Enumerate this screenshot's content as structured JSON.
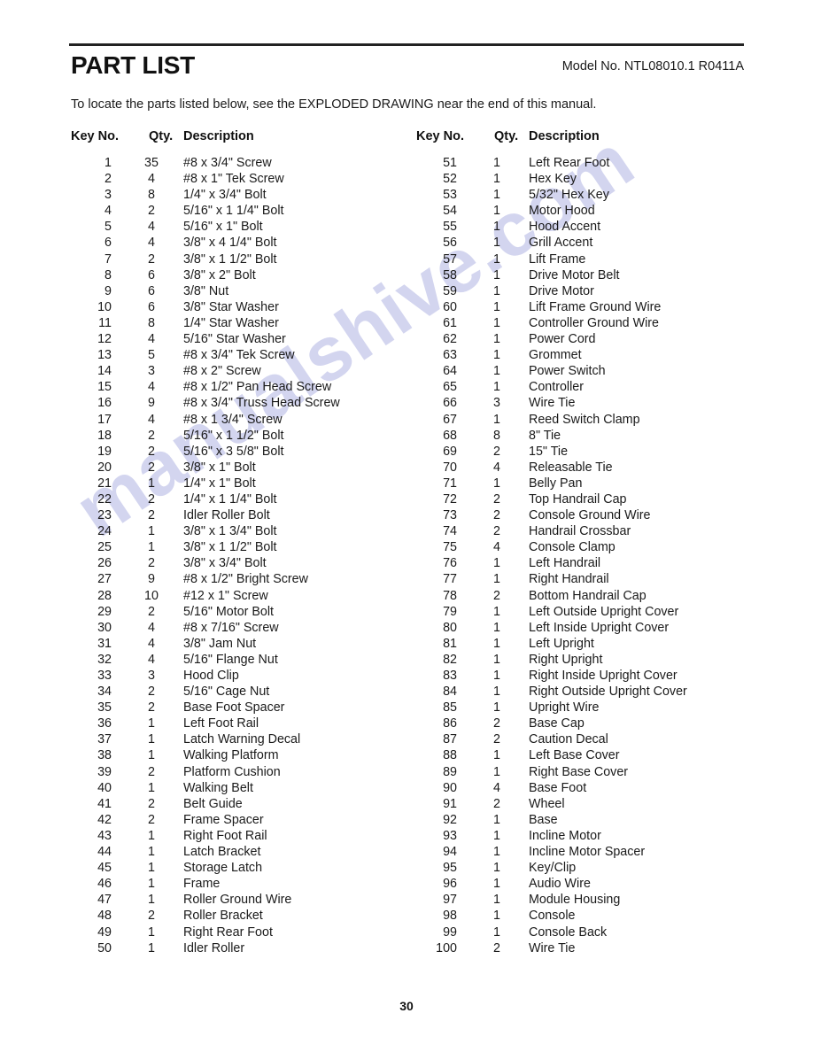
{
  "document": {
    "title": "PART LIST",
    "model_no": "Model No. NTL08010.1 R0411A",
    "intro": "To locate the parts listed below, see the EXPLODED DRAWING near the end of this manual.",
    "page_number": "30",
    "watermark": "manualshive.com",
    "watermark_color": "#b9bce6",
    "rule_color": "#222222"
  },
  "table": {
    "headers": {
      "key_no": "Key No.",
      "qty": "Qty.",
      "description": "Description"
    },
    "left_column": [
      {
        "key": "1",
        "qty": "35",
        "description": "#8 x 3/4\" Screw"
      },
      {
        "key": "2",
        "qty": "4",
        "description": "#8 x 1\" Tek Screw"
      },
      {
        "key": "3",
        "qty": "8",
        "description": "1/4\" x 3/4\" Bolt"
      },
      {
        "key": "4",
        "qty": "2",
        "description": "5/16\" x 1 1/4\" Bolt"
      },
      {
        "key": "5",
        "qty": "4",
        "description": "5/16\" x 1\" Bolt"
      },
      {
        "key": "6",
        "qty": "4",
        "description": "3/8\" x 4 1/4\" Bolt"
      },
      {
        "key": "7",
        "qty": "2",
        "description": "3/8\" x 1 1/2\" Bolt"
      },
      {
        "key": "8",
        "qty": "6",
        "description": "3/8\" x 2\" Bolt"
      },
      {
        "key": "9",
        "qty": "6",
        "description": "3/8\" Nut"
      },
      {
        "key": "10",
        "qty": "6",
        "description": "3/8\" Star Washer"
      },
      {
        "key": "11",
        "qty": "8",
        "description": "1/4\" Star Washer"
      },
      {
        "key": "12",
        "qty": "4",
        "description": "5/16\" Star Washer"
      },
      {
        "key": "13",
        "qty": "5",
        "description": "#8 x 3/4\" Tek Screw"
      },
      {
        "key": "14",
        "qty": "3",
        "description": "#8 x 2\" Screw"
      },
      {
        "key": "15",
        "qty": "4",
        "description": "#8 x 1/2\" Pan Head Screw"
      },
      {
        "key": "16",
        "qty": "9",
        "description": "#8 x 3/4\" Truss Head Screw"
      },
      {
        "key": "17",
        "qty": "4",
        "description": "#8 x 1 3/4\" Screw"
      },
      {
        "key": "18",
        "qty": "2",
        "description": "5/16\" x 1 1/2\" Bolt"
      },
      {
        "key": "19",
        "qty": "2",
        "description": "5/16\" x 3 5/8\" Bolt"
      },
      {
        "key": "20",
        "qty": "2",
        "description": "3/8\" x 1\" Bolt"
      },
      {
        "key": "21",
        "qty": "1",
        "description": "1/4\" x 1\" Bolt"
      },
      {
        "key": "22",
        "qty": "2",
        "description": "1/4\" x 1 1/4\" Bolt"
      },
      {
        "key": "23",
        "qty": "2",
        "description": "Idler Roller Bolt"
      },
      {
        "key": "24",
        "qty": "1",
        "description": "3/8\" x 1 3/4\" Bolt"
      },
      {
        "key": "25",
        "qty": "1",
        "description": "3/8\" x 1 1/2\" Bolt"
      },
      {
        "key": "26",
        "qty": "2",
        "description": "3/8\" x 3/4\" Bolt"
      },
      {
        "key": "27",
        "qty": "9",
        "description": "#8 x 1/2\" Bright Screw"
      },
      {
        "key": "28",
        "qty": "10",
        "description": "#12 x 1\" Screw"
      },
      {
        "key": "29",
        "qty": "2",
        "description": "5/16\" Motor Bolt"
      },
      {
        "key": "30",
        "qty": "4",
        "description": "#8 x 7/16\" Screw"
      },
      {
        "key": "31",
        "qty": "4",
        "description": "3/8\" Jam Nut"
      },
      {
        "key": "32",
        "qty": "4",
        "description": "5/16\" Flange Nut"
      },
      {
        "key": "33",
        "qty": "3",
        "description": "Hood Clip"
      },
      {
        "key": "34",
        "qty": "2",
        "description": "5/16\" Cage Nut"
      },
      {
        "key": "35",
        "qty": "2",
        "description": "Base Foot Spacer"
      },
      {
        "key": "36",
        "qty": "1",
        "description": "Left Foot Rail"
      },
      {
        "key": "37",
        "qty": "1",
        "description": "Latch Warning Decal"
      },
      {
        "key": "38",
        "qty": "1",
        "description": "Walking Platform"
      },
      {
        "key": "39",
        "qty": "2",
        "description": "Platform Cushion"
      },
      {
        "key": "40",
        "qty": "1",
        "description": "Walking Belt"
      },
      {
        "key": "41",
        "qty": "2",
        "description": "Belt Guide"
      },
      {
        "key": "42",
        "qty": "2",
        "description": "Frame Spacer"
      },
      {
        "key": "43",
        "qty": "1",
        "description": "Right Foot Rail"
      },
      {
        "key": "44",
        "qty": "1",
        "description": "Latch Bracket"
      },
      {
        "key": "45",
        "qty": "1",
        "description": "Storage Latch"
      },
      {
        "key": "46",
        "qty": "1",
        "description": "Frame"
      },
      {
        "key": "47",
        "qty": "1",
        "description": "Roller Ground Wire"
      },
      {
        "key": "48",
        "qty": "2",
        "description": "Roller Bracket"
      },
      {
        "key": "49",
        "qty": "1",
        "description": "Right Rear Foot"
      },
      {
        "key": "50",
        "qty": "1",
        "description": "Idler Roller"
      }
    ],
    "right_column": [
      {
        "key": "51",
        "qty": "1",
        "description": "Left Rear Foot"
      },
      {
        "key": "52",
        "qty": "1",
        "description": "Hex Key"
      },
      {
        "key": "53",
        "qty": "1",
        "description": "5/32\" Hex Key"
      },
      {
        "key": "54",
        "qty": "1",
        "description": "Motor Hood"
      },
      {
        "key": "55",
        "qty": "1",
        "description": "Hood Accent"
      },
      {
        "key": "56",
        "qty": "1",
        "description": "Grill Accent"
      },
      {
        "key": "57",
        "qty": "1",
        "description": "Lift Frame"
      },
      {
        "key": "58",
        "qty": "1",
        "description": "Drive Motor Belt"
      },
      {
        "key": "59",
        "qty": "1",
        "description": "Drive Motor"
      },
      {
        "key": "60",
        "qty": "1",
        "description": "Lift Frame Ground Wire"
      },
      {
        "key": "61",
        "qty": "1",
        "description": "Controller Ground Wire"
      },
      {
        "key": "62",
        "qty": "1",
        "description": "Power Cord"
      },
      {
        "key": "63",
        "qty": "1",
        "description": "Grommet"
      },
      {
        "key": "64",
        "qty": "1",
        "description": "Power Switch"
      },
      {
        "key": "65",
        "qty": "1",
        "description": "Controller"
      },
      {
        "key": "66",
        "qty": "3",
        "description": "Wire Tie"
      },
      {
        "key": "67",
        "qty": "1",
        "description": "Reed Switch Clamp"
      },
      {
        "key": "68",
        "qty": "8",
        "description": "8\" Tie"
      },
      {
        "key": "69",
        "qty": "2",
        "description": "15\" Tie"
      },
      {
        "key": "70",
        "qty": "4",
        "description": "Releasable Tie"
      },
      {
        "key": "71",
        "qty": "1",
        "description": "Belly Pan"
      },
      {
        "key": "72",
        "qty": "2",
        "description": "Top Handrail Cap"
      },
      {
        "key": "73",
        "qty": "2",
        "description": "Console Ground Wire"
      },
      {
        "key": "74",
        "qty": "2",
        "description": "Handrail Crossbar"
      },
      {
        "key": "75",
        "qty": "4",
        "description": "Console Clamp"
      },
      {
        "key": "76",
        "qty": "1",
        "description": "Left Handrail"
      },
      {
        "key": "77",
        "qty": "1",
        "description": "Right Handrail"
      },
      {
        "key": "78",
        "qty": "2",
        "description": "Bottom Handrail Cap"
      },
      {
        "key": "79",
        "qty": "1",
        "description": "Left Outside Upright Cover"
      },
      {
        "key": "80",
        "qty": "1",
        "description": "Left Inside Upright Cover"
      },
      {
        "key": "81",
        "qty": "1",
        "description": "Left Upright"
      },
      {
        "key": "82",
        "qty": "1",
        "description": "Right Upright"
      },
      {
        "key": "83",
        "qty": "1",
        "description": "Right Inside Upright Cover"
      },
      {
        "key": "84",
        "qty": "1",
        "description": "Right Outside Upright Cover"
      },
      {
        "key": "85",
        "qty": "1",
        "description": "Upright Wire"
      },
      {
        "key": "86",
        "qty": "2",
        "description": "Base Cap"
      },
      {
        "key": "87",
        "qty": "2",
        "description": "Caution Decal"
      },
      {
        "key": "88",
        "qty": "1",
        "description": "Left Base Cover"
      },
      {
        "key": "89",
        "qty": "1",
        "description": "Right Base Cover"
      },
      {
        "key": "90",
        "qty": "4",
        "description": "Base Foot"
      },
      {
        "key": "91",
        "qty": "2",
        "description": "Wheel"
      },
      {
        "key": "92",
        "qty": "1",
        "description": "Base"
      },
      {
        "key": "93",
        "qty": "1",
        "description": "Incline Motor"
      },
      {
        "key": "94",
        "qty": "1",
        "description": "Incline Motor Spacer"
      },
      {
        "key": "95",
        "qty": "1",
        "description": "Key/Clip"
      },
      {
        "key": "96",
        "qty": "1",
        "description": "Audio Wire"
      },
      {
        "key": "97",
        "qty": "1",
        "description": "Module Housing"
      },
      {
        "key": "98",
        "qty": "1",
        "description": "Console"
      },
      {
        "key": "99",
        "qty": "1",
        "description": "Console Back"
      },
      {
        "key": "100",
        "qty": "2",
        "description": "Wire Tie"
      }
    ]
  }
}
